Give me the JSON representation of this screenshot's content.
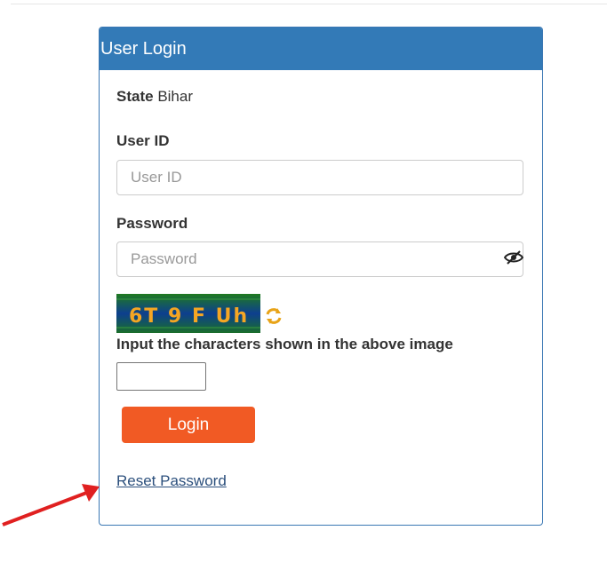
{
  "panel": {
    "title": "User Login"
  },
  "state": {
    "label": "State",
    "value": "Bihar"
  },
  "user_id": {
    "label": "User ID",
    "placeholder": "User ID"
  },
  "password": {
    "label": "Password",
    "placeholder": "Password"
  },
  "captcha": {
    "image_text": "6T 9 F Uh",
    "instruction": "Input the characters shown in the above image"
  },
  "login_button": {
    "label": "Login"
  },
  "reset_link": {
    "label": "Reset Password"
  },
  "colors": {
    "header": "#337ab7",
    "login_button": "#f15a24",
    "link": "#2b4f7c",
    "arrow": "#e02020"
  },
  "icons": {
    "eye": "eye-slash-icon",
    "refresh": "refresh-icon",
    "arrow": "red-arrow-annotation"
  }
}
